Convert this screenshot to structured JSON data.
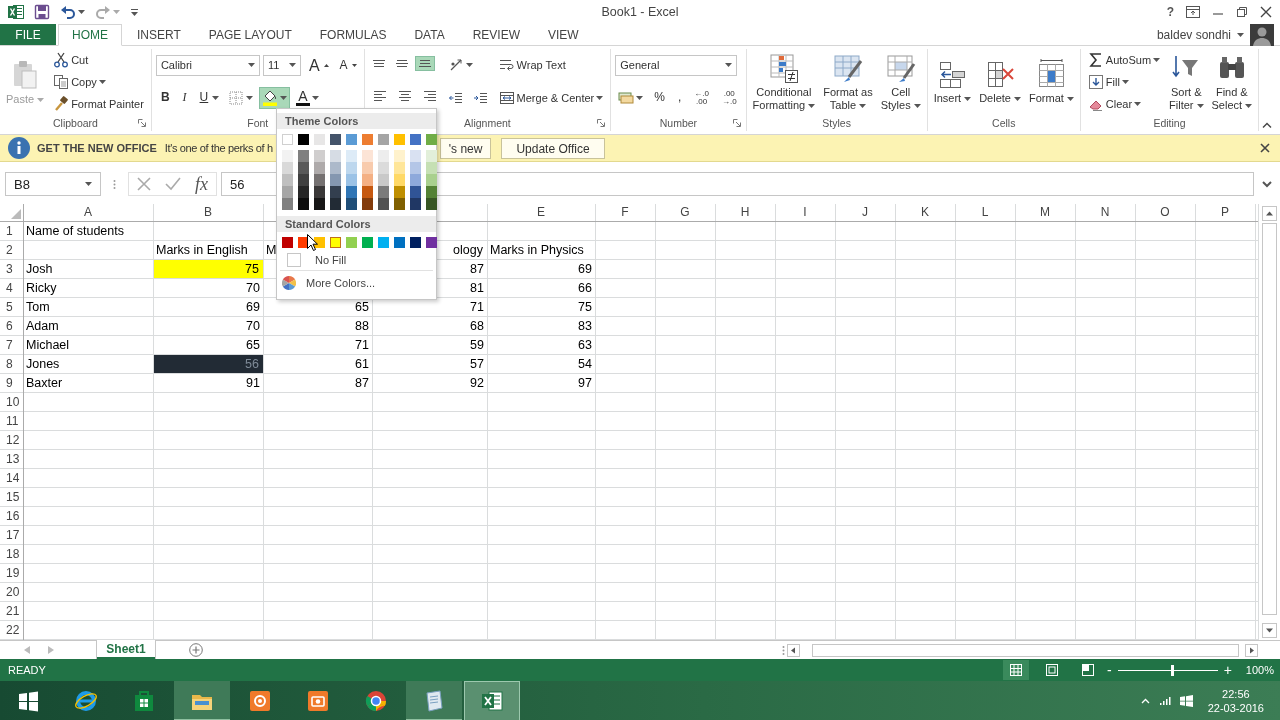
{
  "title_bar": {
    "title": "Book1 - Excel",
    "help": "?"
  },
  "account": {
    "name": "baldev sondhi"
  },
  "tabs": [
    {
      "label": "FILE",
      "kind": "file",
      "selected": false
    },
    {
      "label": "HOME",
      "kind": "tab",
      "selected": true
    },
    {
      "label": "INSERT",
      "kind": "tab",
      "selected": false
    },
    {
      "label": "PAGE LAYOUT",
      "kind": "tab",
      "selected": false
    },
    {
      "label": "FORMULAS",
      "kind": "tab",
      "selected": false
    },
    {
      "label": "DATA",
      "kind": "tab",
      "selected": false
    },
    {
      "label": "REVIEW",
      "kind": "tab",
      "selected": false
    },
    {
      "label": "VIEW",
      "kind": "tab",
      "selected": false
    }
  ],
  "ribbon": {
    "groups": [
      {
        "label": "Clipboard",
        "launcher": true,
        "columns": [
          [
            [
              {
                "kind": "large",
                "lines": [
                  "Paste"
                ],
                "caret": true,
                "disabled": true
              }
            ]
          ],
          [
            [
              {
                "kind": "small",
                "label": "Cut",
                "disabled": false
              }
            ],
            [
              {
                "kind": "small",
                "label": "Copy",
                "caret": true,
                "disabled": false
              }
            ],
            [
              {
                "kind": "small",
                "label": "Format Painter",
                "disabled": false
              }
            ]
          ]
        ]
      },
      {
        "label": "Font",
        "columns": [
          [
            [
              {
                "kind": "field",
                "value": "Calibri",
                "caret": true
              },
              {
                "kind": "field",
                "value": "11",
                "caret": true
              },
              {
                "kind": "glyph",
                "label": "A"
              },
              {
                "kind": "glyph",
                "label": "A"
              }
            ],
            [
              {
                "kind": "glyph",
                "label": "B",
                "active": false
              },
              {
                "kind": "glyph",
                "label": "I",
                "active": false
              },
              {
                "kind": "glyph",
                "label": "U",
                "caret": true,
                "active": false
              },
              {
                "kind": "icon",
                "caret": true
              },
              {
                "kind": "icon",
                "caret": true,
                "active": true
              },
              {
                "kind": "glyph",
                "label": "A",
                "caret": true
              }
            ]
          ]
        ]
      },
      {
        "label": "Alignment",
        "launcher": true,
        "columns": [
          [
            [
              {
                "kind": "icon",
                "active": false
              },
              {
                "kind": "icon",
                "active": false
              },
              {
                "kind": "icon",
                "active": true
              }
            ],
            [
              {
                "kind": "icon",
                "active": false
              },
              {
                "kind": "icon",
                "active": false
              },
              {
                "kind": "icon",
                "active": false
              }
            ]
          ],
          [
            [
              {
                "kind": "icon",
                "caret": true
              }
            ],
            [
              {
                "kind": "icon"
              },
              {
                "kind": "icon"
              }
            ]
          ],
          [
            [
              {
                "kind": "small",
                "label": "Wrap Text"
              }
            ],
            [
              {
                "kind": "small",
                "label": "Merge & Center",
                "caret": true
              }
            ]
          ]
        ]
      },
      {
        "label": "Number",
        "launcher": true,
        "columns": [
          [
            [
              {
                "kind": "field",
                "value": "General",
                "caret": true
              }
            ],
            [
              {
                "kind": "icon",
                "caret": true
              },
              {
                "kind": "glyph",
                "label": "%"
              },
              {
                "kind": "glyph",
                "label": ","
              },
              {
                "kind": "glyph",
                "label": "←.0\n.00"
              },
              {
                "kind": "glyph",
                "label": ".00\n→.0"
              }
            ]
          ]
        ]
      },
      {
        "label": "Styles",
        "launcher": false,
        "columns": [
          [
            [
              {
                "kind": "large",
                "lines": [
                  "Conditional",
                  "Formatting"
                ],
                "caret": true
              }
            ]
          ],
          [
            [
              {
                "kind": "large",
                "lines": [
                  "Format as",
                  "Table"
                ],
                "caret": true
              }
            ]
          ],
          [
            [
              {
                "kind": "large",
                "lines": [
                  "Cell",
                  "Styles"
                ],
                "caret": true
              }
            ]
          ]
        ]
      },
      {
        "label": "Cells",
        "launcher": false,
        "columns": [
          [
            [
              {
                "kind": "large",
                "lines": [
                  "Insert"
                ],
                "caret": true
              }
            ]
          ],
          [
            [
              {
                "kind": "large",
                "lines": [
                  "Delete"
                ],
                "caret": true
              }
            ]
          ],
          [
            [
              {
                "kind": "large",
                "lines": [
                  "Format"
                ],
                "caret": true
              }
            ]
          ]
        ]
      },
      {
        "label": "Editing",
        "launcher": false,
        "columns": [
          [
            [
              {
                "kind": "small",
                "label": "AutoSum",
                "caret": true
              }
            ],
            [
              {
                "kind": "small",
                "label": "Fill",
                "caret": true
              }
            ],
            [
              {
                "kind": "small",
                "label": "Clear",
                "caret": true
              }
            ]
          ],
          [
            [
              {
                "kind": "large",
                "lines": [
                  "Sort &",
                  "Filter"
                ],
                "caret": true
              }
            ]
          ],
          [
            [
              {
                "kind": "large",
                "lines": [
                  "Find &",
                  "Select"
                ],
                "caret": true
              }
            ]
          ]
        ]
      }
    ]
  },
  "info_bar": {
    "title": "GET THE NEW OFFICE",
    "message": "It's one of the perks of h",
    "buttons": [
      {
        "label": "'s new"
      },
      {
        "label": "Update Office"
      }
    ]
  },
  "formula_bar": {
    "name_box": "B8",
    "fx": "fx",
    "value": "56"
  },
  "sheet": {
    "columns": [
      "A",
      "B",
      null,
      null,
      "E",
      "F",
      "G",
      "H",
      "I",
      "J",
      "K",
      "L",
      "M",
      "N",
      "O",
      "P"
    ],
    "rows": [
      {
        "number": "1",
        "cells": [
          {
            "text": "Name of students",
            "kind": "text"
          }
        ]
      },
      {
        "number": "2",
        "cells": [
          null,
          {
            "text": "Marks in English",
            "kind": "text"
          },
          {
            "text": "M",
            "kind": "text"
          },
          {
            "text": "ology",
            "kind": "text",
            "clipped": true
          },
          {
            "text": "Marks in Physics",
            "kind": "text"
          }
        ]
      },
      {
        "number": "3",
        "cells": [
          {
            "text": "Josh",
            "kind": "text"
          },
          {
            "text": "75",
            "kind": "number",
            "color": "#ffff00"
          },
          null,
          {
            "text": "87",
            "kind": "number"
          },
          {
            "text": "69",
            "kind": "number"
          }
        ]
      },
      {
        "number": "4",
        "cells": [
          {
            "text": "Ricky",
            "kind": "text"
          },
          {
            "text": "70",
            "kind": "number"
          },
          null,
          {
            "text": "81",
            "kind": "number"
          },
          {
            "text": "66",
            "kind": "number"
          }
        ]
      },
      {
        "number": "5",
        "cells": [
          {
            "text": "Tom",
            "kind": "text"
          },
          {
            "text": "69",
            "kind": "number"
          },
          {
            "text": "65",
            "kind": "number"
          },
          {
            "text": "71",
            "kind": "number"
          },
          {
            "text": "75",
            "kind": "number"
          }
        ]
      },
      {
        "number": "6",
        "cells": [
          {
            "text": "Adam",
            "kind": "text"
          },
          {
            "text": "70",
            "kind": "number"
          },
          {
            "text": "88",
            "kind": "number"
          },
          {
            "text": "68",
            "kind": "number"
          },
          {
            "text": "83",
            "kind": "number"
          }
        ]
      },
      {
        "number": "7",
        "cells": [
          {
            "text": "Michael",
            "kind": "text"
          },
          {
            "text": "65",
            "kind": "number"
          },
          {
            "text": "71",
            "kind": "number"
          },
          {
            "text": "59",
            "kind": "number"
          },
          {
            "text": "63",
            "kind": "number"
          }
        ]
      },
      {
        "number": "8",
        "cells": [
          {
            "text": "Jones",
            "kind": "text"
          },
          {
            "text": "56",
            "kind": "number",
            "color": "#222b35"
          },
          {
            "text": "61",
            "kind": "number"
          },
          {
            "text": "57",
            "kind": "number"
          },
          {
            "text": "54",
            "kind": "number"
          }
        ]
      },
      {
        "number": "9",
        "cells": [
          {
            "text": "Baxter",
            "kind": "text"
          },
          {
            "text": "91",
            "kind": "number"
          },
          {
            "text": "87",
            "kind": "number"
          },
          {
            "text": "92",
            "kind": "number"
          },
          {
            "text": "97",
            "kind": "number"
          }
        ]
      },
      {
        "number": "10"
      },
      {
        "number": "11"
      },
      {
        "number": "12"
      },
      {
        "number": "13"
      },
      {
        "number": "14"
      },
      {
        "number": "15"
      },
      {
        "number": "16"
      },
      {
        "number": "17"
      },
      {
        "number": "18"
      },
      {
        "number": "19"
      },
      {
        "number": "20"
      },
      {
        "number": "21"
      },
      {
        "number": "22"
      }
    ]
  },
  "palette": {
    "theme_title": "Theme Colors",
    "theme_colors": [
      {
        "color": "#ffffff",
        "shades": [
          {
            "color": "#f2f2f2"
          },
          {
            "color": "#d9d9d9"
          },
          {
            "color": "#bfbfbf"
          },
          {
            "color": "#a6a6a6"
          },
          {
            "color": "#808080"
          }
        ]
      },
      {
        "color": "#000000",
        "shades": [
          {
            "color": "#808080"
          },
          {
            "color": "#595959"
          },
          {
            "color": "#404040"
          },
          {
            "color": "#262626"
          },
          {
            "color": "#0d0d0d"
          }
        ]
      },
      {
        "color": "#e7e6e6",
        "shades": [
          {
            "color": "#d0cece"
          },
          {
            "color": "#aeaaaa"
          },
          {
            "color": "#757171"
          },
          {
            "color": "#3a3838"
          },
          {
            "color": "#171616"
          }
        ]
      },
      {
        "color": "#44546a",
        "shades": [
          {
            "color": "#d6dce4"
          },
          {
            "color": "#acb9ca"
          },
          {
            "color": "#8497b0"
          },
          {
            "color": "#333f4f"
          },
          {
            "color": "#222b35"
          }
        ]
      },
      {
        "color": "#5b9bd5",
        "shades": [
          {
            "color": "#ddebf7"
          },
          {
            "color": "#bdd7ee"
          },
          {
            "color": "#9bc2e6"
          },
          {
            "color": "#2f75b5"
          },
          {
            "color": "#1f4e78"
          }
        ]
      },
      {
        "color": "#ed7d31",
        "shades": [
          {
            "color": "#fce4d6"
          },
          {
            "color": "#f8cbad"
          },
          {
            "color": "#f4b084"
          },
          {
            "color": "#c65911"
          },
          {
            "color": "#833c0c"
          }
        ]
      },
      {
        "color": "#a5a5a5",
        "shades": [
          {
            "color": "#ededed"
          },
          {
            "color": "#dbdbdb"
          },
          {
            "color": "#c9c9c9"
          },
          {
            "color": "#7b7b7b"
          },
          {
            "color": "#525252"
          }
        ]
      },
      {
        "color": "#ffc000",
        "shades": [
          {
            "color": "#fff2cc"
          },
          {
            "color": "#ffe699"
          },
          {
            "color": "#ffd966"
          },
          {
            "color": "#bf8f00"
          },
          {
            "color": "#806000"
          }
        ]
      },
      {
        "color": "#4472c4",
        "shades": [
          {
            "color": "#d9e1f2"
          },
          {
            "color": "#b4c6e7"
          },
          {
            "color": "#8ea9db"
          },
          {
            "color": "#305496"
          },
          {
            "color": "#203764"
          }
        ]
      },
      {
        "color": "#70ad47",
        "shades": [
          {
            "color": "#e2efda"
          },
          {
            "color": "#c6e0b4"
          },
          {
            "color": "#a9d08e"
          },
          {
            "color": "#548235"
          },
          {
            "color": "#375623"
          }
        ]
      }
    ],
    "standard_title": "Standard Colors",
    "standard_colors": [
      {
        "color": "#c00000",
        "selected": false
      },
      {
        "color": "#ff3c00",
        "selected": false
      },
      {
        "color": "#ffc000",
        "selected": false
      },
      {
        "color": "#ffff00",
        "selected": true
      },
      {
        "color": "#92d050",
        "selected": false
      },
      {
        "color": "#00b050",
        "selected": false
      },
      {
        "color": "#00b0f0",
        "selected": false
      },
      {
        "color": "#0070c0",
        "selected": false
      },
      {
        "color": "#002060",
        "selected": false
      },
      {
        "color": "#7030a0",
        "selected": false
      }
    ],
    "no_fill": "No Fill",
    "more_colors": "More Colors..."
  },
  "sheet_tabs": [
    {
      "label": "Sheet1",
      "selected": true
    }
  ],
  "status_bar": {
    "status": "READY",
    "views": [
      {
        "selected": true
      },
      {
        "selected": false
      },
      {
        "selected": false
      }
    ],
    "zoom_out": "-",
    "zoom_in": "+",
    "zoom": {
      "level": 0.54
    },
    "zoom_reading": "100%"
  },
  "taskbar": {
    "apps": [
      {
        "running": false,
        "active": false
      },
      {
        "running": false,
        "active": false
      },
      {
        "running": false,
        "active": false
      },
      {
        "running": true,
        "active": false
      },
      {
        "running": false,
        "active": false
      },
      {
        "running": false,
        "active": false
      },
      {
        "running": false,
        "active": false
      },
      {
        "running": true,
        "active": false
      },
      {
        "running": true,
        "active": true
      }
    ],
    "time": "22:56",
    "date": "22-03-2016"
  }
}
